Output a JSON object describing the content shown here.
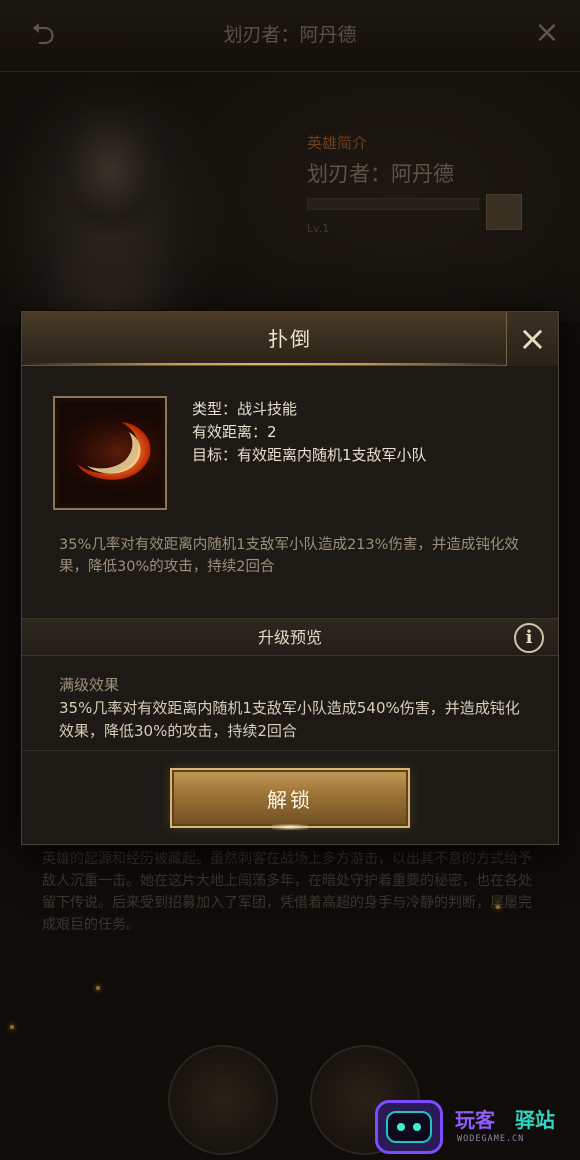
{
  "background": {
    "nav_title": "划刃者：阿丹德",
    "section_title": "英雄简介",
    "hero_name": "划刃者：阿丹德",
    "hero_sub": "Lv.1",
    "lore_text": "英雄的起源和经历被藏起。虽然刺客在战场上多方游击，以出其不意的方式给予敌人沉重一击。她在这片大地上闯荡多年，在暗处守护着重要的秘密，也在各处留下传说。后来受到招募加入了军团，凭借着高超的身手与冷静的判断，屡屡完成艰巨的任务。"
  },
  "modal": {
    "title": "扑倒",
    "close_icon": "close-icon",
    "skill": {
      "icon": "crescent-slash-icon",
      "type_line": "类型：战斗技能",
      "range_line": "有效距离：2",
      "target_line": "目标：有效距离内随机1支敌军小队"
    },
    "description": "35%几率对有效距离内随机1支敌军小队造成213%伤害，并造成钝化效果，降低30%的攻击，持续2回合",
    "upgrade_preview": {
      "title": "升级预览",
      "info_icon": "info-icon",
      "max_label": "满级效果",
      "max_text": "35%几率对有效距离内随机1支敌军小队造成540%伤害，并造成钝化效果，降低30%的攻击，持续2回合"
    },
    "unlock_button": "解锁"
  },
  "watermark": {
    "text_left": "玩客",
    "text_right": "驿站",
    "url": "WODEGAME.CN"
  },
  "colors": {
    "accent_gold": "#c49a58",
    "panel_bg": "#1d1a16",
    "text_muted": "#9c8f7b"
  }
}
